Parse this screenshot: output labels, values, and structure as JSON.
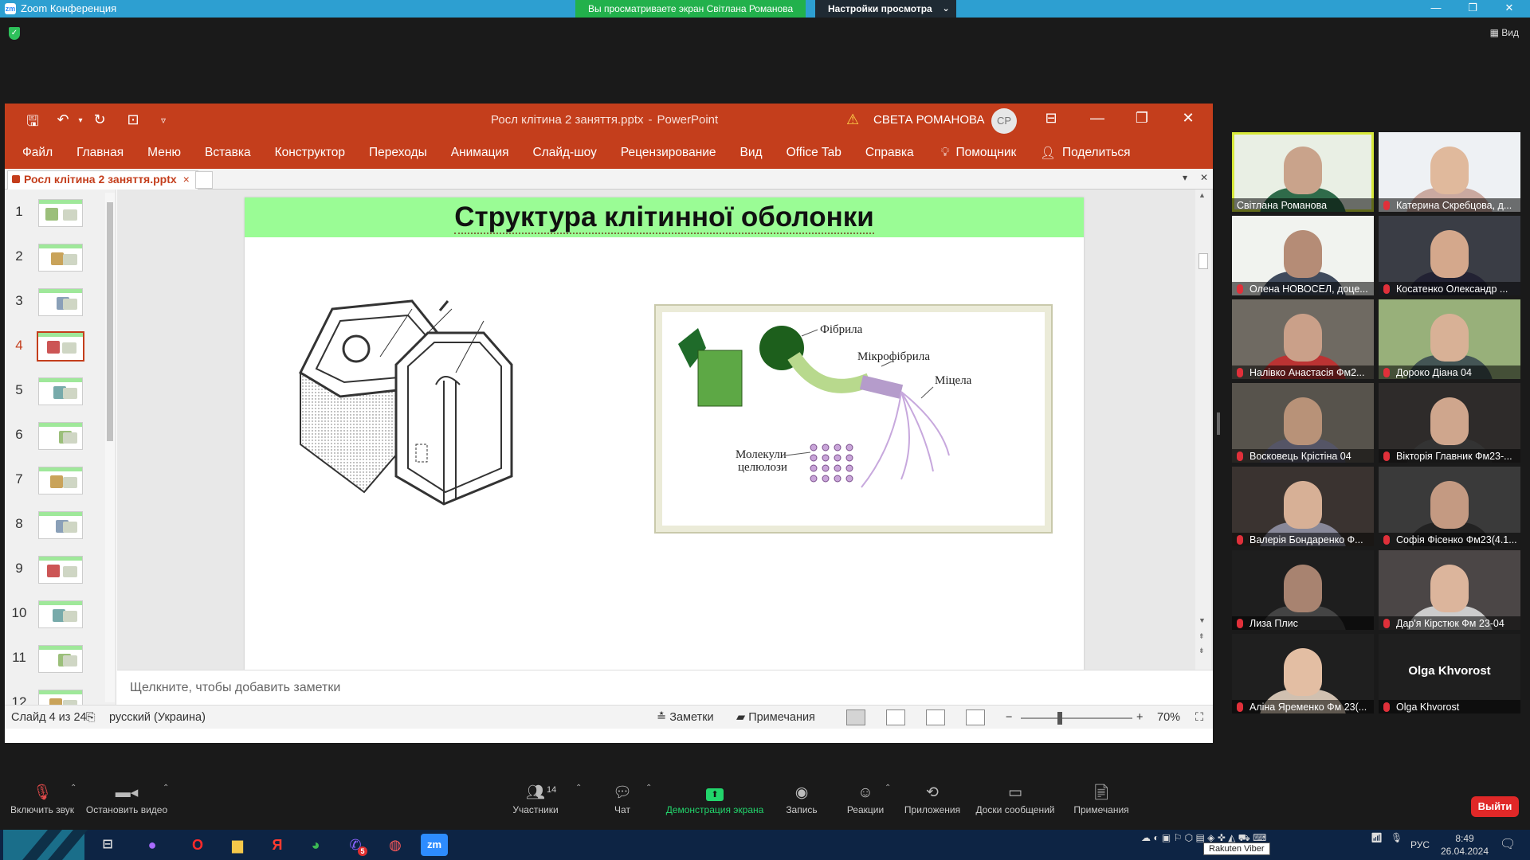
{
  "zoom": {
    "app_title": "Zoom Конференция",
    "share_banner": "Вы просматриваете экран Світлана Романова",
    "view_options": "Настройки просмотра",
    "view_button": "Вид",
    "toolbar": {
      "mute": "Включить звук",
      "stop_video": "Остановить видео",
      "participants": "Участники",
      "participants_count": "14",
      "chat": "Чат",
      "share_screen": "Демонстрация экрана",
      "record": "Запись",
      "reactions": "Реакции",
      "apps": "Приложения",
      "whiteboards": "Доски сообщений",
      "notes": "Примечания",
      "leave": "Выйти"
    },
    "participants": [
      {
        "name": "Світлана Романова",
        "active": true,
        "muted": false
      },
      {
        "name": "Катерина Скребцова, д...",
        "muted": true
      },
      {
        "name": "Олена НОВОСЕЛ, доце...",
        "muted": true
      },
      {
        "name": "Косатенко Олександр ...",
        "muted": true
      },
      {
        "name": "Налівко Анастасія Фм2...",
        "muted": true
      },
      {
        "name": "Дороко Діана 04",
        "muted": true
      },
      {
        "name": "Восковець Крістіна 04",
        "muted": true
      },
      {
        "name": "Вікторія Главник Фм23-...",
        "muted": true
      },
      {
        "name": "Валерія Бондаренко Ф...",
        "muted": true
      },
      {
        "name": "Софія Фісенко Фм23(4.1...",
        "muted": true
      },
      {
        "name": "Лиза Плис",
        "muted": true
      },
      {
        "name": "Дар'я Кірстюк Фм 23-04",
        "muted": true
      },
      {
        "name": "Аліна Яременко Фм 23(...",
        "muted": true
      },
      {
        "name": "Olga Khvorost",
        "muted": true,
        "video_off_label": "Olga Khvorost"
      }
    ]
  },
  "ppt": {
    "file_name": "Росл клітина 2 заняття.pptx",
    "app_name": "PowerPoint",
    "user_name": "СВЕТА РОМАНОВА",
    "user_initials": "СР",
    "ribbon": [
      "Файл",
      "Главная",
      "Меню",
      "Вставка",
      "Конструктор",
      "Переходы",
      "Анимация",
      "Слайд-шоу",
      "Рецензирование",
      "Вид",
      "Office Tab",
      "Справка"
    ],
    "helper": "Помощник",
    "share": "Поделиться",
    "doc_tab": "Росл клітина 2 заняття.pptx",
    "slide_numbers": [
      "1",
      "2",
      "3",
      "4",
      "5",
      "6",
      "7",
      "8",
      "9",
      "10",
      "11",
      "12"
    ],
    "selected_slide": 4,
    "slide_title": "Структура клітинної оболонки",
    "figure_labels": {
      "fibril": "Фібрила",
      "microfibril": "Мікрофібрила",
      "micelle": "Міцела",
      "cellulose_1": "Молекули",
      "cellulose_2": "целюлози"
    },
    "notes_placeholder": "Щелкните, чтобы добавить заметки",
    "status": {
      "slide": "Слайд 4 из 24",
      "language": "русский (Украина)",
      "notes": "Заметки",
      "comments": "Примечания",
      "zoom": "70%"
    }
  },
  "taskbar": {
    "lang": "РУС",
    "time": "8:49",
    "date": "26.04.2024",
    "tooltip": "Rakuten Viber",
    "viber_badge": "5"
  },
  "colors": {
    "ppt_red": "#c43e1c",
    "slide_banner": "#9afc95",
    "zoom_green": "#22d46b",
    "leave_red": "#e02828"
  }
}
